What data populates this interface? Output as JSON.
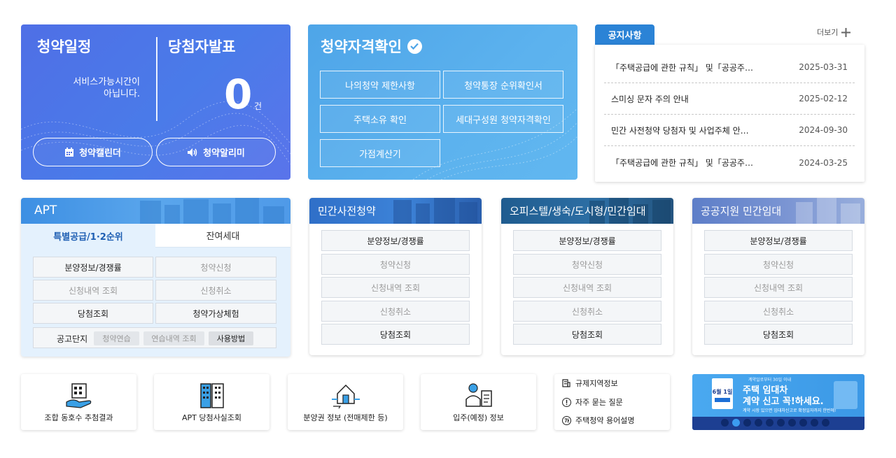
{
  "schedule": {
    "title": "청약일정",
    "winner_title": "당첨자발표",
    "service_msg_line1": "서비스가능시간이",
    "service_msg_line2": "아닙니다.",
    "count": "0",
    "count_unit": "건",
    "calendar_btn": "청약캘린더",
    "alarm_btn": "청약알리미"
  },
  "qualification": {
    "title": "청약자격확인",
    "buttons": [
      "나의청약 제한사항",
      "청약통장 순위확인서",
      "주택소유 확인",
      "세대구성원 청약자격확인",
      "가점계산기"
    ]
  },
  "notice": {
    "tab": "공지사항",
    "more": "더보기",
    "items": [
      {
        "title": "「주택공급에 관한 규칙」 및「공공주…",
        "date": "2025-03-31"
      },
      {
        "title": "스미싱 문자 주의 안내",
        "date": "2025-02-12"
      },
      {
        "title": "민간 사전청약 당첨자 및 사업주체 안…",
        "date": "2024-09-30"
      },
      {
        "title": "「주택공급에 관한 규칙」 및「공공주…",
        "date": "2024-03-25"
      }
    ]
  },
  "apt": {
    "title": "APT",
    "tab_special": "특별공급/1·2순위",
    "tab_remaining": "잔여세대",
    "buttons": [
      "분양정보/경쟁률",
      "청약신청",
      "신청내역 조회",
      "신청취소",
      "당첨조회",
      "청약가상체험"
    ],
    "notice_label": "공고단지",
    "chips": [
      "청약연습",
      "연습내역 조회",
      "사용방법"
    ]
  },
  "sub_cards": [
    {
      "title": "민간사전청약",
      "buttons": [
        "분양정보/경쟁률",
        "청약신청",
        "신청내역 조회",
        "신청취소",
        "당첨조회"
      ]
    },
    {
      "title": "오피스텔/생숙/도시형/민간임대",
      "buttons": [
        "분양정보/경쟁률",
        "청약신청",
        "신청내역 조회",
        "신청취소",
        "당첨조회"
      ]
    },
    {
      "title": "공공지원 민간임대",
      "buttons": [
        "분양정보/경쟁률",
        "청약신청",
        "신청내역 조회",
        "신청취소",
        "당첨조회"
      ]
    }
  ],
  "quick": [
    {
      "label": "조합 동호수 추첨결과",
      "icon": "building-hand-icon"
    },
    {
      "label": "APT 당첨사실조회",
      "icon": "apartment-icon"
    },
    {
      "label": "분양권 정보 (전매제한 등)",
      "icon": "house-exchange-icon"
    },
    {
      "label": "입주(예정) 정보",
      "icon": "resident-icon"
    }
  ],
  "links": [
    {
      "label": "규제지역정보",
      "icon": "building-icon"
    },
    {
      "label": "자주 묻는 질문",
      "icon": "exclamation-icon"
    },
    {
      "label": "주택청약 용어설명",
      "icon": "glossary-icon"
    }
  ],
  "banner": {
    "small": "계약일로부터 30일 이내",
    "headline1": "주택 임대차",
    "headline2": "계약 신고 꼭!하세요.",
    "sub": "계약 시장 있으면 임대차신고로 확정일자까지 한번에!",
    "date_badge": "6월 1일",
    "dots": 10,
    "active_dot": 1
  },
  "colors": {
    "schedule_bg": "#4f6fe6",
    "qual_bg": "#54acec",
    "accent_blue": "#2b83d6",
    "apt_bg": "#e4f1fd"
  }
}
